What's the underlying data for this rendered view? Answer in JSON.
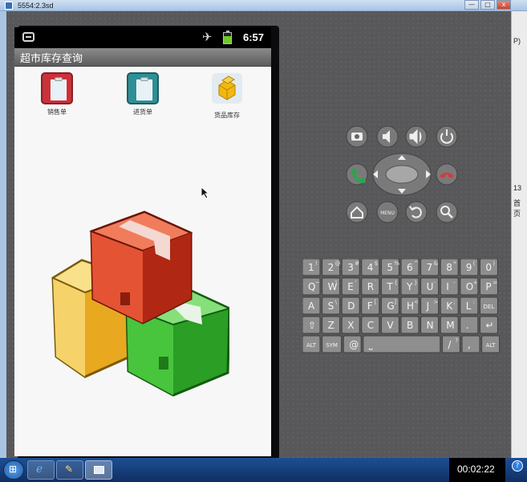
{
  "window": {
    "title": "5554:2.3sd",
    "minimize_glyph": "—",
    "maximize_glyph": "□",
    "close_glyph": "x",
    "behind_texts": [
      "P)",
      "13",
      "首页"
    ]
  },
  "status_bar": {
    "time": "6:57"
  },
  "app": {
    "title": "超市库存查询",
    "menu": [
      {
        "label": "销售单",
        "icon": "sales-order-icon",
        "color": "#c9323a"
      },
      {
        "label": "进货单",
        "icon": "purchase-order-icon",
        "color": "#2f8f96"
      },
      {
        "label": "货品库存",
        "icon": "inventory-icon",
        "color": "#f2b80f"
      }
    ]
  },
  "controls": {
    "menu_label": "MENU"
  },
  "keyboard": {
    "rows": [
      [
        [
          "1",
          "!"
        ],
        [
          "2",
          "@"
        ],
        [
          "3",
          "#"
        ],
        [
          "4",
          "$"
        ],
        [
          "5",
          "%"
        ],
        [
          "6",
          "^"
        ],
        [
          "7",
          "&"
        ],
        [
          "8",
          "*"
        ],
        [
          "9",
          "("
        ],
        [
          "0",
          ")"
        ]
      ],
      [
        [
          "Q",
          "~"
        ],
        [
          "W",
          "\""
        ],
        [
          "E",
          "'"
        ],
        [
          "R",
          "`"
        ],
        [
          "T",
          "{"
        ],
        [
          "Y",
          "}"
        ],
        [
          "U",
          "-"
        ],
        [
          "I",
          "-"
        ],
        [
          "O",
          "+"
        ],
        [
          "P",
          "="
        ]
      ],
      [
        [
          "A",
          ""
        ],
        [
          "S",
          "\\"
        ],
        [
          "D",
          ""
        ],
        [
          "F",
          "["
        ],
        [
          "G",
          "]"
        ],
        [
          "H",
          "<"
        ],
        [
          "J",
          ">"
        ],
        [
          "K",
          ";"
        ],
        [
          "L",
          ":"
        ],
        [
          "DEL",
          ""
        ]
      ],
      [
        [
          "⇧",
          ""
        ],
        [
          "Z",
          ""
        ],
        [
          "X",
          ""
        ],
        [
          "C",
          ""
        ],
        [
          "V",
          ""
        ],
        [
          "B",
          ""
        ],
        [
          "N",
          ""
        ],
        [
          "M",
          ""
        ],
        [
          ".",
          ""
        ],
        [
          "↵",
          ""
        ]
      ],
      [
        [
          "ALT",
          ""
        ],
        [
          "SYM",
          ""
        ],
        [
          "@",
          ""
        ],
        [
          "⎵",
          ""
        ],
        [
          "/",
          "?"
        ],
        [
          ",",
          ""
        ],
        [
          "ALT",
          ""
        ]
      ]
    ]
  },
  "taskbar": {
    "clock": "00:02:22"
  },
  "colors": {
    "emulator_body": "#58585a",
    "screen_bg": "#f7f7f7",
    "taskbar": "#123a78"
  }
}
